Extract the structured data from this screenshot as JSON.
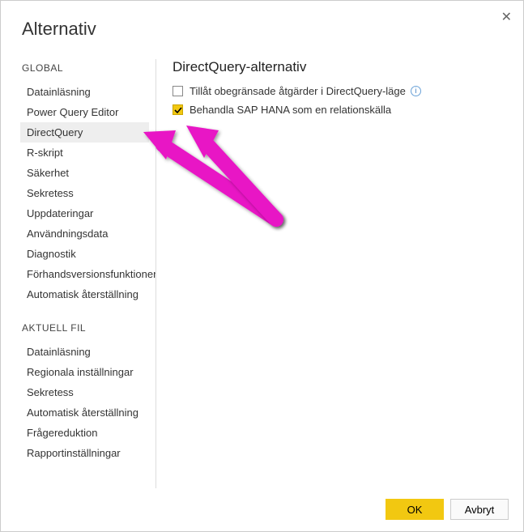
{
  "title": "Alternativ",
  "sections": {
    "global": {
      "header": "GLOBAL",
      "items": [
        "Datainläsning",
        "Power Query Editor",
        "DirectQuery",
        "R-skript",
        "Säkerhet",
        "Sekretess",
        "Uppdateringar",
        "Användningsdata",
        "Diagnostik",
        "Förhandsversionsfunktioner",
        "Automatisk återställning"
      ]
    },
    "current": {
      "header": "AKTUELL FIL",
      "items": [
        "Datainläsning",
        "Regionala inställningar",
        "Sekretess",
        "Automatisk återställning",
        "Frågereduktion",
        "Rapportinställningar"
      ]
    }
  },
  "main": {
    "heading": "DirectQuery-alternativ",
    "option1": "Tillåt obegränsade åtgärder i DirectQuery-läge",
    "option2": "Behandla SAP HANA som en relationskälla"
  },
  "buttons": {
    "ok": "OK",
    "cancel": "Avbryt"
  }
}
